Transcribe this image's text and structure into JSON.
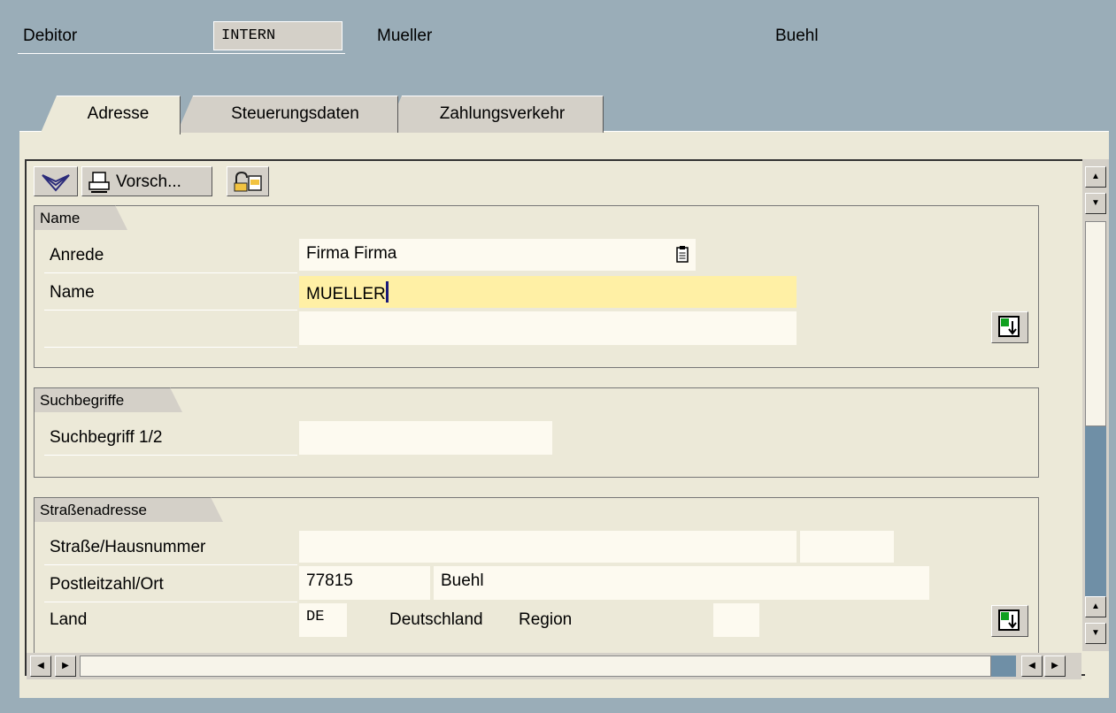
{
  "header": {
    "label": "Debitor",
    "account_group": "INTERN",
    "name": "Mueller",
    "city": "Buehl"
  },
  "tabs": [
    {
      "label": "Adresse",
      "active": true
    },
    {
      "label": "Steuerungsdaten",
      "active": false
    },
    {
      "label": "Zahlungsverkehr",
      "active": false
    }
  ],
  "toolbar": {
    "preview_label": "Vorsch..."
  },
  "groups": {
    "name": {
      "title": "Name",
      "anrede_label": "Anrede",
      "anrede_value": "Firma Firma",
      "name_label": "Name",
      "name_value": "MUELLER",
      "name2_value": ""
    },
    "search": {
      "title": "Suchbegriffe",
      "search_label": "Suchbegriff 1/2",
      "search_value": ""
    },
    "street": {
      "title": "Straßenadresse",
      "street_label": "Straße/Hausnummer",
      "street_value": "",
      "house_value": "",
      "postal_label": "Postleitzahl/Ort",
      "postal_value": "77815",
      "city_value": "Buehl",
      "country_label": "Land",
      "country_value": "DE",
      "country_name": "Deutschland",
      "region_label": "Region",
      "region_value": ""
    }
  },
  "colors": {
    "background": "#9aadb8",
    "panel": "#ece9d8",
    "field": "#fdfaf0",
    "active_field": "#fff0a5"
  }
}
